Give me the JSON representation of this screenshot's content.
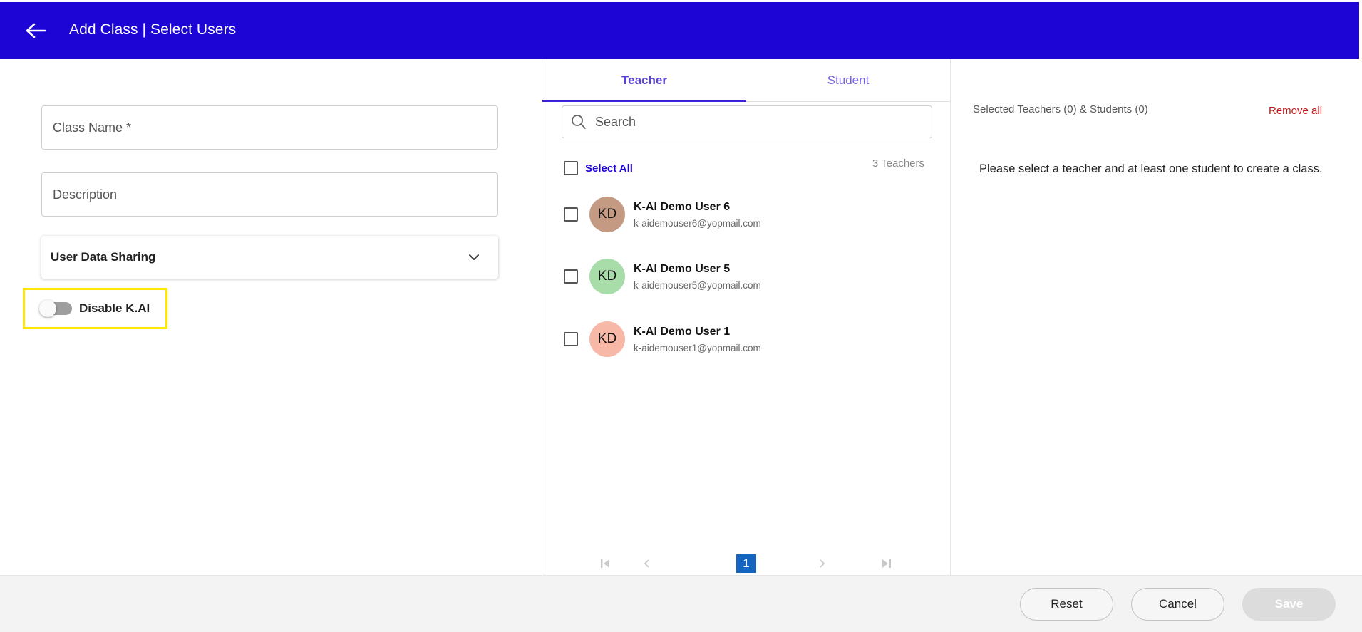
{
  "header": {
    "title": "Add Class | Select Users",
    "bg_color": "#1d05d6"
  },
  "form": {
    "class_name_placeholder": "Class Name *",
    "description_placeholder": "Description",
    "data_sharing_label": "User Data Sharing",
    "disable_kai_label": "Disable K.AI",
    "disable_kai_enabled": false
  },
  "tabs": [
    {
      "label": "Teacher",
      "active": true
    },
    {
      "label": "Student",
      "active": false
    }
  ],
  "search": {
    "placeholder": "Search"
  },
  "list": {
    "select_all_label": "Select All",
    "count_text": "3 Teachers",
    "users": [
      {
        "initials": "KD",
        "name": "K-AI Demo User 6",
        "email": "k-aidemouser6@yopmail.com",
        "avatar_color": "#c49a82"
      },
      {
        "initials": "KD",
        "name": "K-AI Demo User 5",
        "email": "k-aidemouser5@yopmail.com",
        "avatar_color": "#a8dca8"
      },
      {
        "initials": "KD",
        "name": "K-AI Demo User 1",
        "email": "k-aidemouser1@yopmail.com",
        "avatar_color": "#f8b8a8"
      }
    ]
  },
  "pagination": {
    "current_page": "1"
  },
  "selection": {
    "summary": "Selected Teachers (0) & Students (0)",
    "remove_all_label": "Remove all",
    "empty_message": "Please select a teacher and at least one student to create a class."
  },
  "footer": {
    "reset_label": "Reset",
    "cancel_label": "Cancel",
    "save_label": "Save"
  }
}
